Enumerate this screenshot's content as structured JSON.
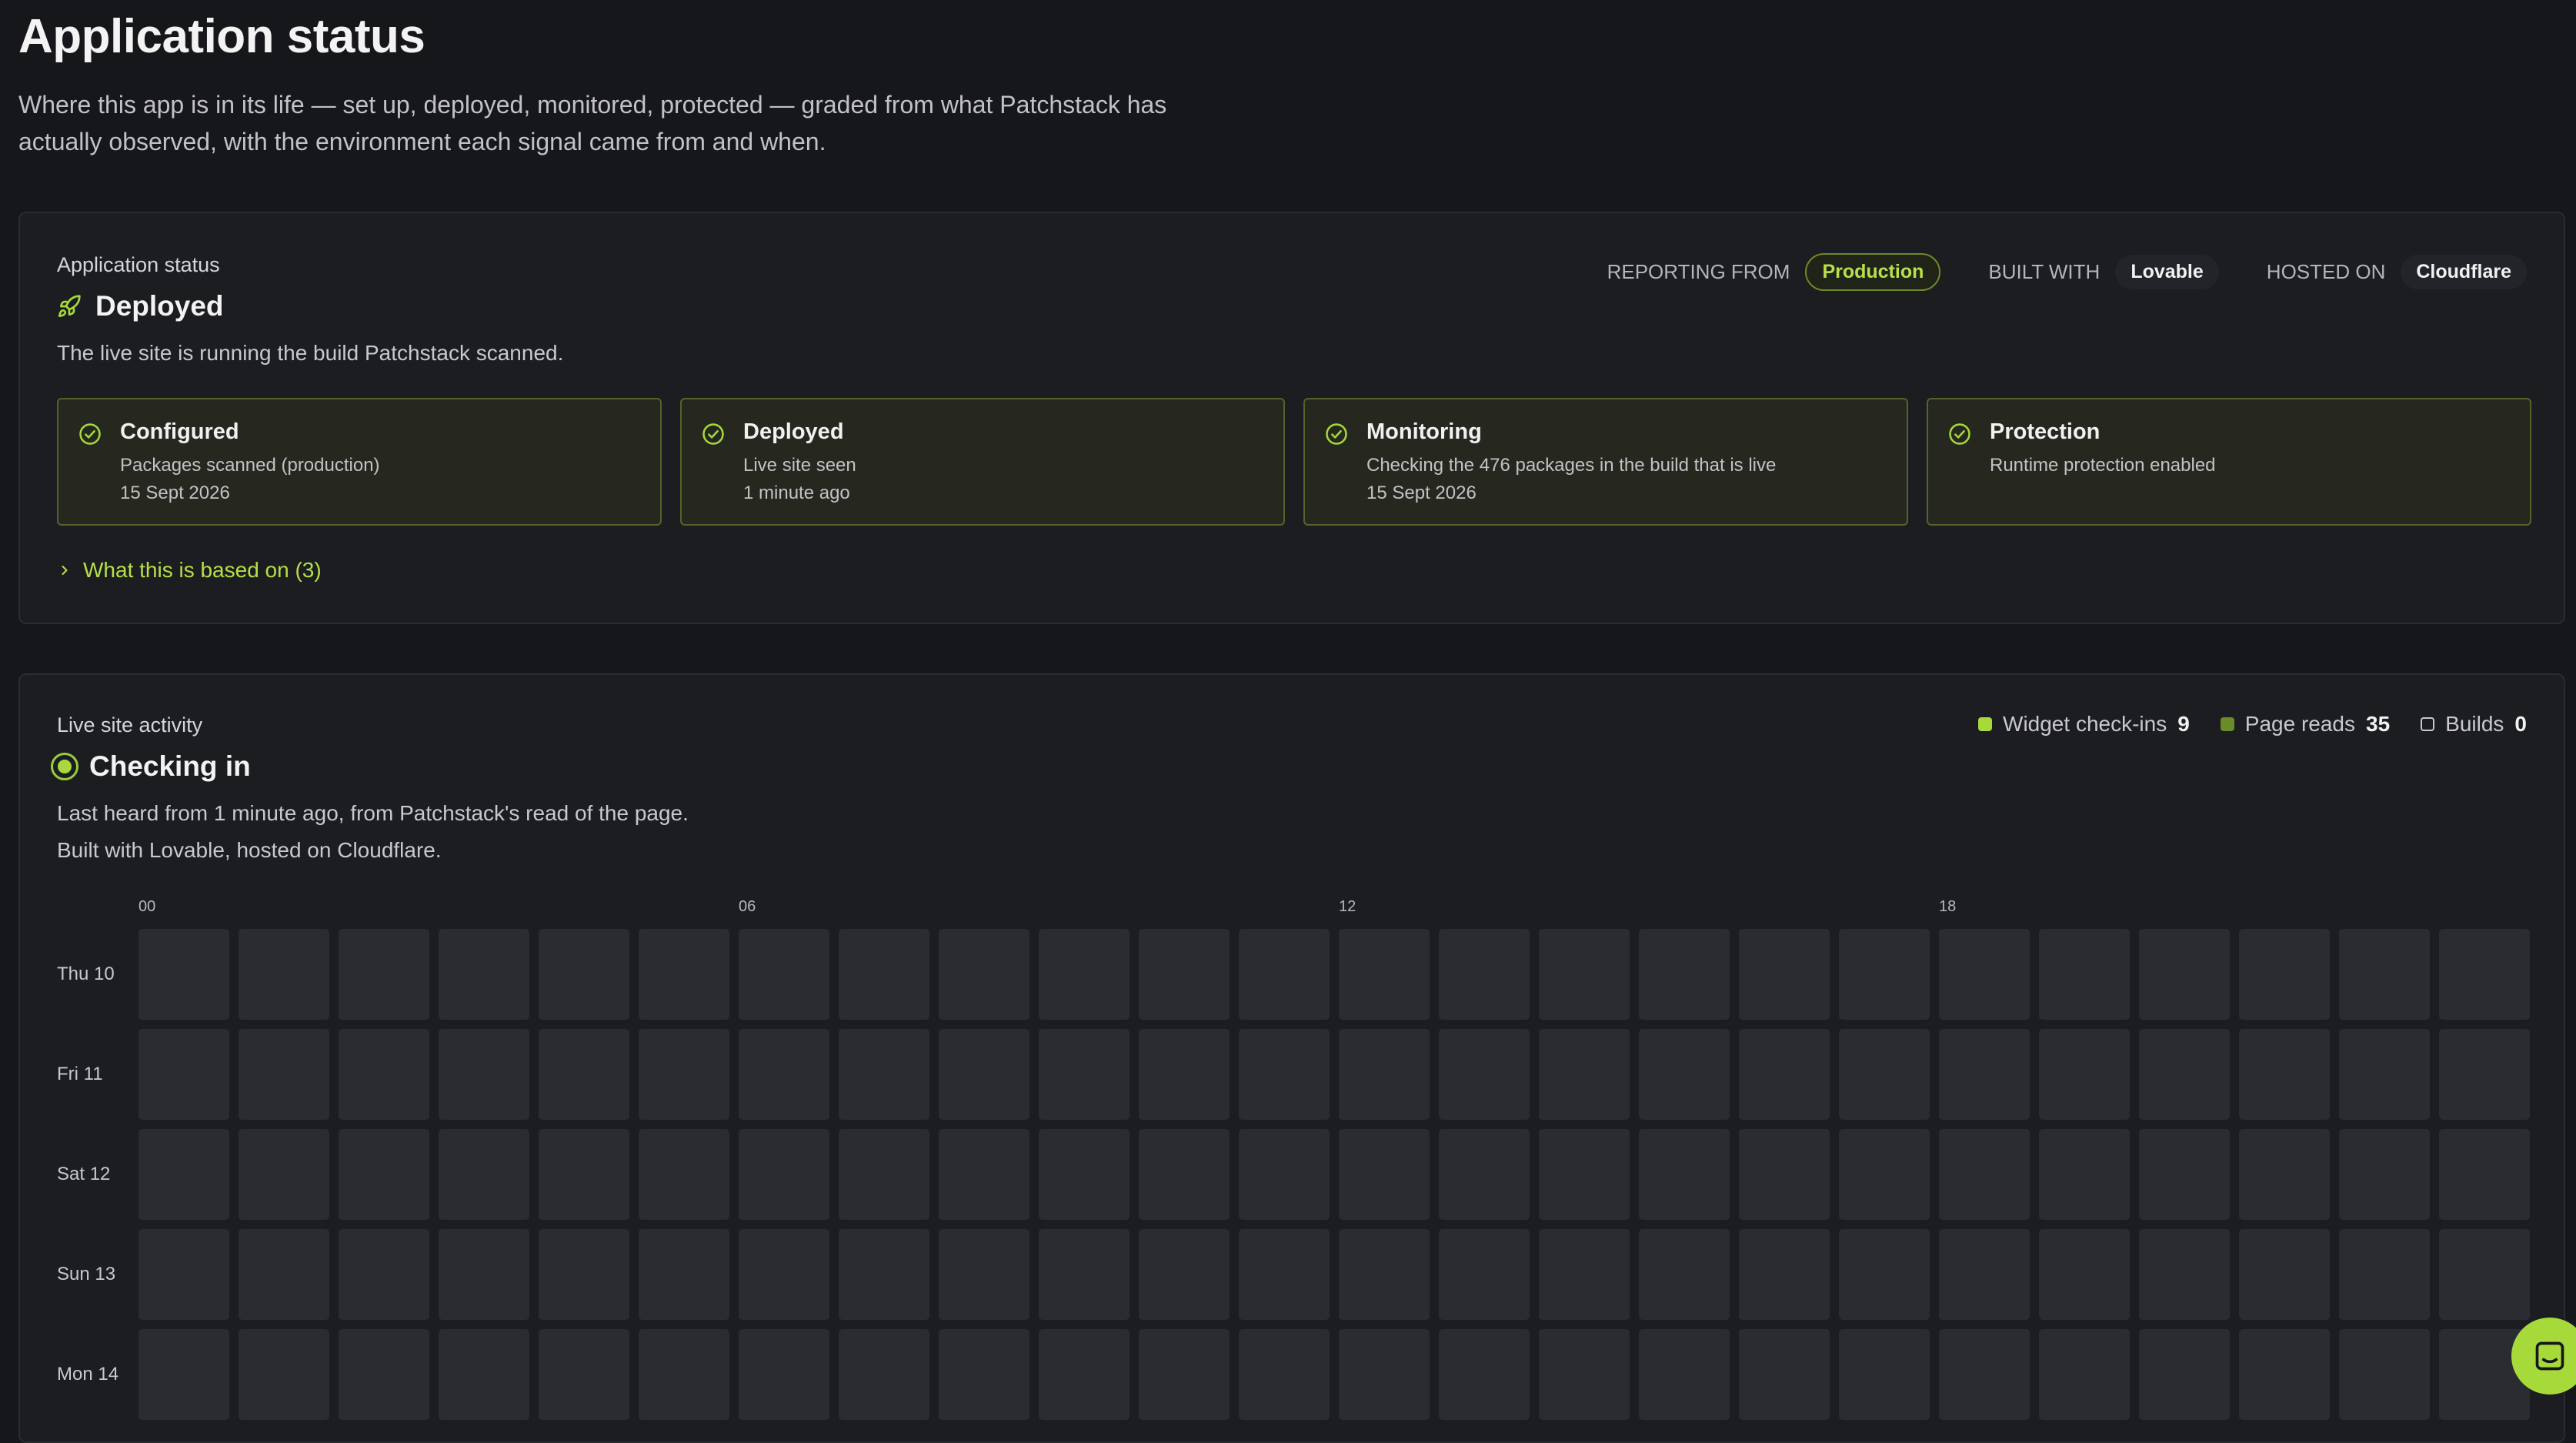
{
  "page": {
    "title": "Application status",
    "description": "Where this app is in its life — set up, deployed, monitored, protected — graded from what Patchstack has actually observed, with the environment each signal came from and when."
  },
  "status_card": {
    "eyebrow": "Application status",
    "state": "Deployed",
    "state_icon": "rocket-icon",
    "summary": "The live site is running the build Patchstack scanned.",
    "meta": {
      "reporting_label": "REPORTING FROM",
      "reporting_value": "Production",
      "built_label": "BUILT WITH",
      "built_value": "Lovable",
      "hosted_label": "HOSTED ON",
      "hosted_value": "Cloudflare"
    },
    "steps": [
      {
        "title": "Configured",
        "line1": "Packages scanned (production)",
        "line2": "15 Sept 2026"
      },
      {
        "title": "Deployed",
        "line1": "Live site seen",
        "line2": "1 minute ago"
      },
      {
        "title": "Monitoring",
        "line1": "Checking the 476 packages in the build that is live",
        "line2": "15 Sept 2026"
      },
      {
        "title": "Protection",
        "line1": "Runtime protection enabled",
        "line2": ""
      }
    ],
    "based_on_label": "What this is based on (3)"
  },
  "activity_card": {
    "eyebrow": "Live site activity",
    "state": "Checking in",
    "line1": "Last heard from 1 minute ago, from Patchstack's read of the page.",
    "line2": "Built with Lovable, hosted on Cloudflare.",
    "legend": [
      {
        "label": "Widget check-ins",
        "count": "9",
        "color": "#a6d93a"
      },
      {
        "label": "Page reads",
        "count": "35",
        "color": "#6b8a2a"
      },
      {
        "label": "Builds",
        "count": "0",
        "color": "transparent"
      }
    ],
    "hour_labels": [
      "00",
      "06",
      "12",
      "18"
    ],
    "days": [
      "Thu 10",
      "Fri 11",
      "Sat 12",
      "Sun 13",
      "Mon 14"
    ]
  },
  "colors": {
    "accent": "#a6d93a",
    "background": "#16171b",
    "card": "#1c1d21",
    "cell_empty": "#2b2c31"
  }
}
